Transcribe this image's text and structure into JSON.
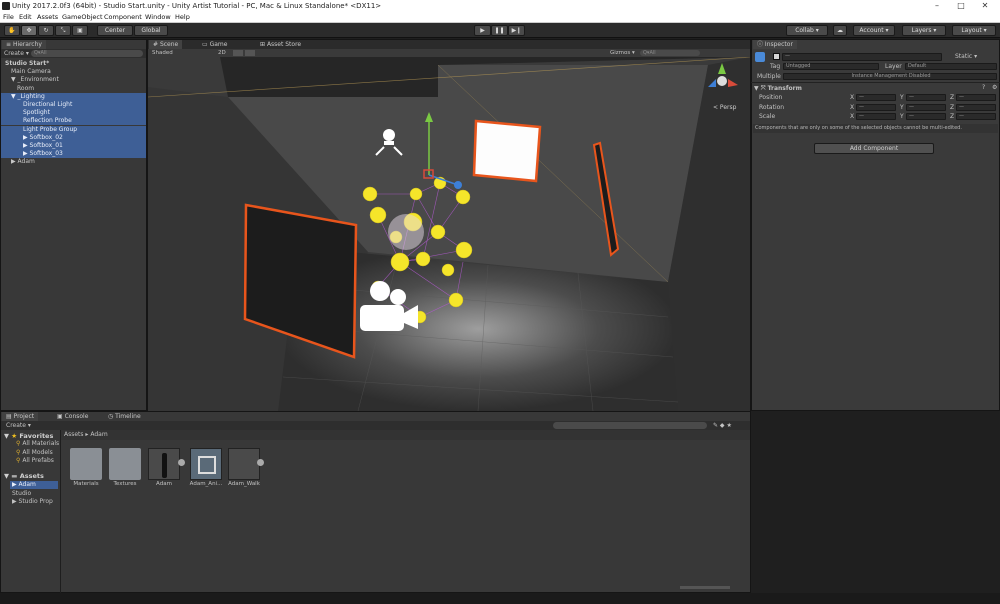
{
  "window": {
    "title": "Unity 2017.2.0f3 (64bit) - Studio Start.unity - Unity Artist Tutorial - PC, Mac & Linux Standalone* <DX11>"
  },
  "menu": [
    "File",
    "Edit",
    "Assets",
    "GameObject",
    "Component",
    "Window",
    "Help"
  ],
  "toolbar": {
    "pivot": "Center",
    "space": "Global",
    "collab": "Collab ▾",
    "account": "Account ▾",
    "layers": "Layers ▾",
    "layout": "Layout ▾"
  },
  "hierarchy": {
    "tab": "Hierarchy",
    "create": "Create ▾",
    "search": "Q▾All",
    "items": [
      {
        "label": "Studio Start*",
        "indent": 0
      },
      {
        "label": "Main Camera",
        "indent": 1
      },
      {
        "label": "▼ _Environment",
        "indent": 1
      },
      {
        "label": "Room",
        "indent": 2
      },
      {
        "label": "▼ _Lighting",
        "indent": 1
      },
      {
        "label": "Directional Light",
        "indent": 3
      },
      {
        "label": "Spotlight",
        "indent": 3
      },
      {
        "label": "Reflection Probe",
        "indent": 3
      },
      {
        "label": "Light Probe Group",
        "indent": 3
      },
      {
        "label": "▶ Softbox_02",
        "indent": 3
      },
      {
        "label": "▶ Softbox_01",
        "indent": 3
      },
      {
        "label": "▶ Softbox_03",
        "indent": 3
      },
      {
        "label": "▶ Adam",
        "indent": 1
      }
    ]
  },
  "scene": {
    "tabs": [
      "Scene",
      "Game",
      "Asset Store"
    ],
    "shading": "Shaded",
    "mode2d": "2D",
    "gizmos": "Gizmos ▾",
    "search": "Q▾All",
    "persp": "< Persp"
  },
  "inspector": {
    "tab": "Inspector",
    "static": "Static ▾",
    "tag_label": "Tag",
    "tag_value": "Untagged",
    "layer_label": "Layer",
    "layer_value": "Default",
    "multiple_label": "Multiple",
    "multiple_value": "Instance Management Disabled",
    "transform_label": "Transform",
    "rows": [
      {
        "label": "Position"
      },
      {
        "label": "Rotation"
      },
      {
        "label": "Scale"
      }
    ],
    "axes": [
      "X",
      "Y",
      "Z"
    ],
    "dash": "—",
    "note": "Components that are only on some of the selected objects cannot be multi-edited.",
    "add_component": "Add Component"
  },
  "bottom": {
    "tabs": [
      "Project",
      "Console",
      "Timeline"
    ],
    "create": "Create ▾",
    "breadcrumb": "Assets ▸ Adam",
    "favorites_label": "Favorites",
    "favorites": [
      "All Materials",
      "All Models",
      "All Prefabs"
    ],
    "assets_label": "Assets",
    "asset_tree": [
      "▶ Adam",
      "Studio",
      "▶ Studio Prop"
    ],
    "assets": [
      "Materials",
      "Textures",
      "Adam",
      "Adam_Ani...",
      "Adam_Walk"
    ]
  },
  "colors": {
    "selection": "#3e5f96",
    "softbox_outline": "#e8551c",
    "light_probe": "#f5e52a"
  }
}
